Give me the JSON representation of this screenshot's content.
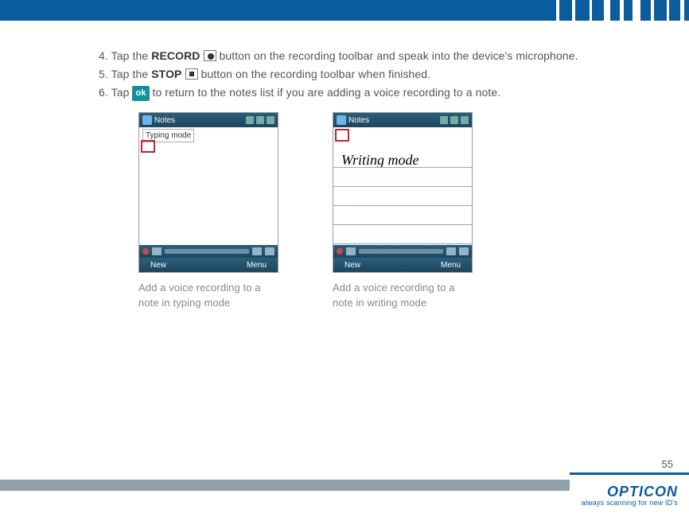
{
  "steps": {
    "s4_pre": "4. Tap the ",
    "s4_bold": "RECORD",
    "s4_post": " button on the recording toolbar and speak into the device's microphone.",
    "s5_pre": "5. Tap the ",
    "s5_bold": "STOP",
    "s5_post": " button on the recording toolbar when finished.",
    "s6_pre": "6. Tap ",
    "s6_ok": "ok",
    "s6_post": " to return to the notes list if you are adding a voice recording to a note."
  },
  "device": {
    "title": "Notes",
    "typing_label": "Typing mode",
    "writing_text": "Writing mode",
    "new_btn": "New",
    "menu_btn": "Menu"
  },
  "captions": {
    "left": "Add a voice recording to a note in typing mode",
    "right": "Add a voice recording to a note in writing mode"
  },
  "footer": {
    "page": "55",
    "brand": "OPTICON",
    "tag": "always scanning for new ID's"
  }
}
